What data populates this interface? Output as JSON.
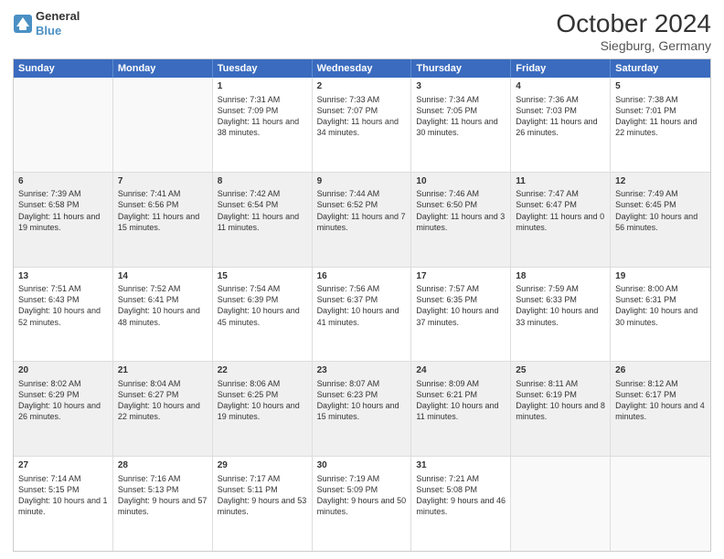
{
  "header": {
    "logo_line1": "General",
    "logo_line2": "Blue",
    "month": "October 2024",
    "location": "Siegburg, Germany"
  },
  "weekdays": [
    "Sunday",
    "Monday",
    "Tuesday",
    "Wednesday",
    "Thursday",
    "Friday",
    "Saturday"
  ],
  "rows": [
    [
      {
        "day": "",
        "info": "",
        "empty": true
      },
      {
        "day": "",
        "info": "",
        "empty": true
      },
      {
        "day": "1",
        "info": "Sunrise: 7:31 AM\nSunset: 7:09 PM\nDaylight: 11 hours and 38 minutes."
      },
      {
        "day": "2",
        "info": "Sunrise: 7:33 AM\nSunset: 7:07 PM\nDaylight: 11 hours and 34 minutes."
      },
      {
        "day": "3",
        "info": "Sunrise: 7:34 AM\nSunset: 7:05 PM\nDaylight: 11 hours and 30 minutes."
      },
      {
        "day": "4",
        "info": "Sunrise: 7:36 AM\nSunset: 7:03 PM\nDaylight: 11 hours and 26 minutes."
      },
      {
        "day": "5",
        "info": "Sunrise: 7:38 AM\nSunset: 7:01 PM\nDaylight: 11 hours and 22 minutes."
      }
    ],
    [
      {
        "day": "6",
        "info": "Sunrise: 7:39 AM\nSunset: 6:58 PM\nDaylight: 11 hours and 19 minutes."
      },
      {
        "day": "7",
        "info": "Sunrise: 7:41 AM\nSunset: 6:56 PM\nDaylight: 11 hours and 15 minutes."
      },
      {
        "day": "8",
        "info": "Sunrise: 7:42 AM\nSunset: 6:54 PM\nDaylight: 11 hours and 11 minutes."
      },
      {
        "day": "9",
        "info": "Sunrise: 7:44 AM\nSunset: 6:52 PM\nDaylight: 11 hours and 7 minutes."
      },
      {
        "day": "10",
        "info": "Sunrise: 7:46 AM\nSunset: 6:50 PM\nDaylight: 11 hours and 3 minutes."
      },
      {
        "day": "11",
        "info": "Sunrise: 7:47 AM\nSunset: 6:47 PM\nDaylight: 11 hours and 0 minutes."
      },
      {
        "day": "12",
        "info": "Sunrise: 7:49 AM\nSunset: 6:45 PM\nDaylight: 10 hours and 56 minutes."
      }
    ],
    [
      {
        "day": "13",
        "info": "Sunrise: 7:51 AM\nSunset: 6:43 PM\nDaylight: 10 hours and 52 minutes."
      },
      {
        "day": "14",
        "info": "Sunrise: 7:52 AM\nSunset: 6:41 PM\nDaylight: 10 hours and 48 minutes."
      },
      {
        "day": "15",
        "info": "Sunrise: 7:54 AM\nSunset: 6:39 PM\nDaylight: 10 hours and 45 minutes."
      },
      {
        "day": "16",
        "info": "Sunrise: 7:56 AM\nSunset: 6:37 PM\nDaylight: 10 hours and 41 minutes."
      },
      {
        "day": "17",
        "info": "Sunrise: 7:57 AM\nSunset: 6:35 PM\nDaylight: 10 hours and 37 minutes."
      },
      {
        "day": "18",
        "info": "Sunrise: 7:59 AM\nSunset: 6:33 PM\nDaylight: 10 hours and 33 minutes."
      },
      {
        "day": "19",
        "info": "Sunrise: 8:00 AM\nSunset: 6:31 PM\nDaylight: 10 hours and 30 minutes."
      }
    ],
    [
      {
        "day": "20",
        "info": "Sunrise: 8:02 AM\nSunset: 6:29 PM\nDaylight: 10 hours and 26 minutes."
      },
      {
        "day": "21",
        "info": "Sunrise: 8:04 AM\nSunset: 6:27 PM\nDaylight: 10 hours and 22 minutes."
      },
      {
        "day": "22",
        "info": "Sunrise: 8:06 AM\nSunset: 6:25 PM\nDaylight: 10 hours and 19 minutes."
      },
      {
        "day": "23",
        "info": "Sunrise: 8:07 AM\nSunset: 6:23 PM\nDaylight: 10 hours and 15 minutes."
      },
      {
        "day": "24",
        "info": "Sunrise: 8:09 AM\nSunset: 6:21 PM\nDaylight: 10 hours and 11 minutes."
      },
      {
        "day": "25",
        "info": "Sunrise: 8:11 AM\nSunset: 6:19 PM\nDaylight: 10 hours and 8 minutes."
      },
      {
        "day": "26",
        "info": "Sunrise: 8:12 AM\nSunset: 6:17 PM\nDaylight: 10 hours and 4 minutes."
      }
    ],
    [
      {
        "day": "27",
        "info": "Sunrise: 7:14 AM\nSunset: 5:15 PM\nDaylight: 10 hours and 1 minute."
      },
      {
        "day": "28",
        "info": "Sunrise: 7:16 AM\nSunset: 5:13 PM\nDaylight: 9 hours and 57 minutes."
      },
      {
        "day": "29",
        "info": "Sunrise: 7:17 AM\nSunset: 5:11 PM\nDaylight: 9 hours and 53 minutes."
      },
      {
        "day": "30",
        "info": "Sunrise: 7:19 AM\nSunset: 5:09 PM\nDaylight: 9 hours and 50 minutes."
      },
      {
        "day": "31",
        "info": "Sunrise: 7:21 AM\nSunset: 5:08 PM\nDaylight: 9 hours and 46 minutes."
      },
      {
        "day": "",
        "info": "",
        "empty": true
      },
      {
        "day": "",
        "info": "",
        "empty": true
      }
    ]
  ]
}
